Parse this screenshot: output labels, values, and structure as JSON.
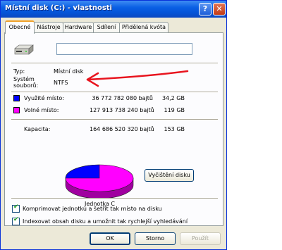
{
  "window": {
    "title": "Místní disk (C:) - vlastnosti",
    "help_label": "?",
    "close_label": "✕"
  },
  "tabs": [
    {
      "label": "Obecné"
    },
    {
      "label": "Nástroje"
    },
    {
      "label": "Hardware"
    },
    {
      "label": "Sdílení"
    },
    {
      "label": "Přidělená kvóta"
    }
  ],
  "general": {
    "name_value": "",
    "type_label": "Typ:",
    "type_value": "Místní disk",
    "fs_label_1": "Systém",
    "fs_label_2": "souborů:",
    "fs_value": "NTFS",
    "used": {
      "label": "Využité místo:",
      "bytes": "36 772 782 080 bajtů",
      "size": "34,2 GB",
      "color": "#0000ff"
    },
    "free": {
      "label": "Volné místo:",
      "bytes": "127 913 738 240 bajtů",
      "size": "119 GB",
      "color": "#ff00ff"
    },
    "capacity": {
      "label": "Kapacita:",
      "bytes": "164 686 520 320 bajtů",
      "size": "153 GB"
    },
    "drive_label": "Jednotka C",
    "cleanup_label": "Vyčištění disku",
    "compress_label": "Komprimovat jednotku a šetřit tak místo na disku",
    "compress_checked": true,
    "index_label": "Indexovat obsah disku a umožnit tak rychlejší vyhledávání",
    "index_checked": true
  },
  "buttons": {
    "ok": "OK",
    "cancel": "Storno",
    "apply": "Použít"
  },
  "colors": {
    "title_bar": "#0554d8",
    "used": "#0000ff",
    "free": "#ff00ff",
    "annotation_arrow": "#e8141e"
  }
}
